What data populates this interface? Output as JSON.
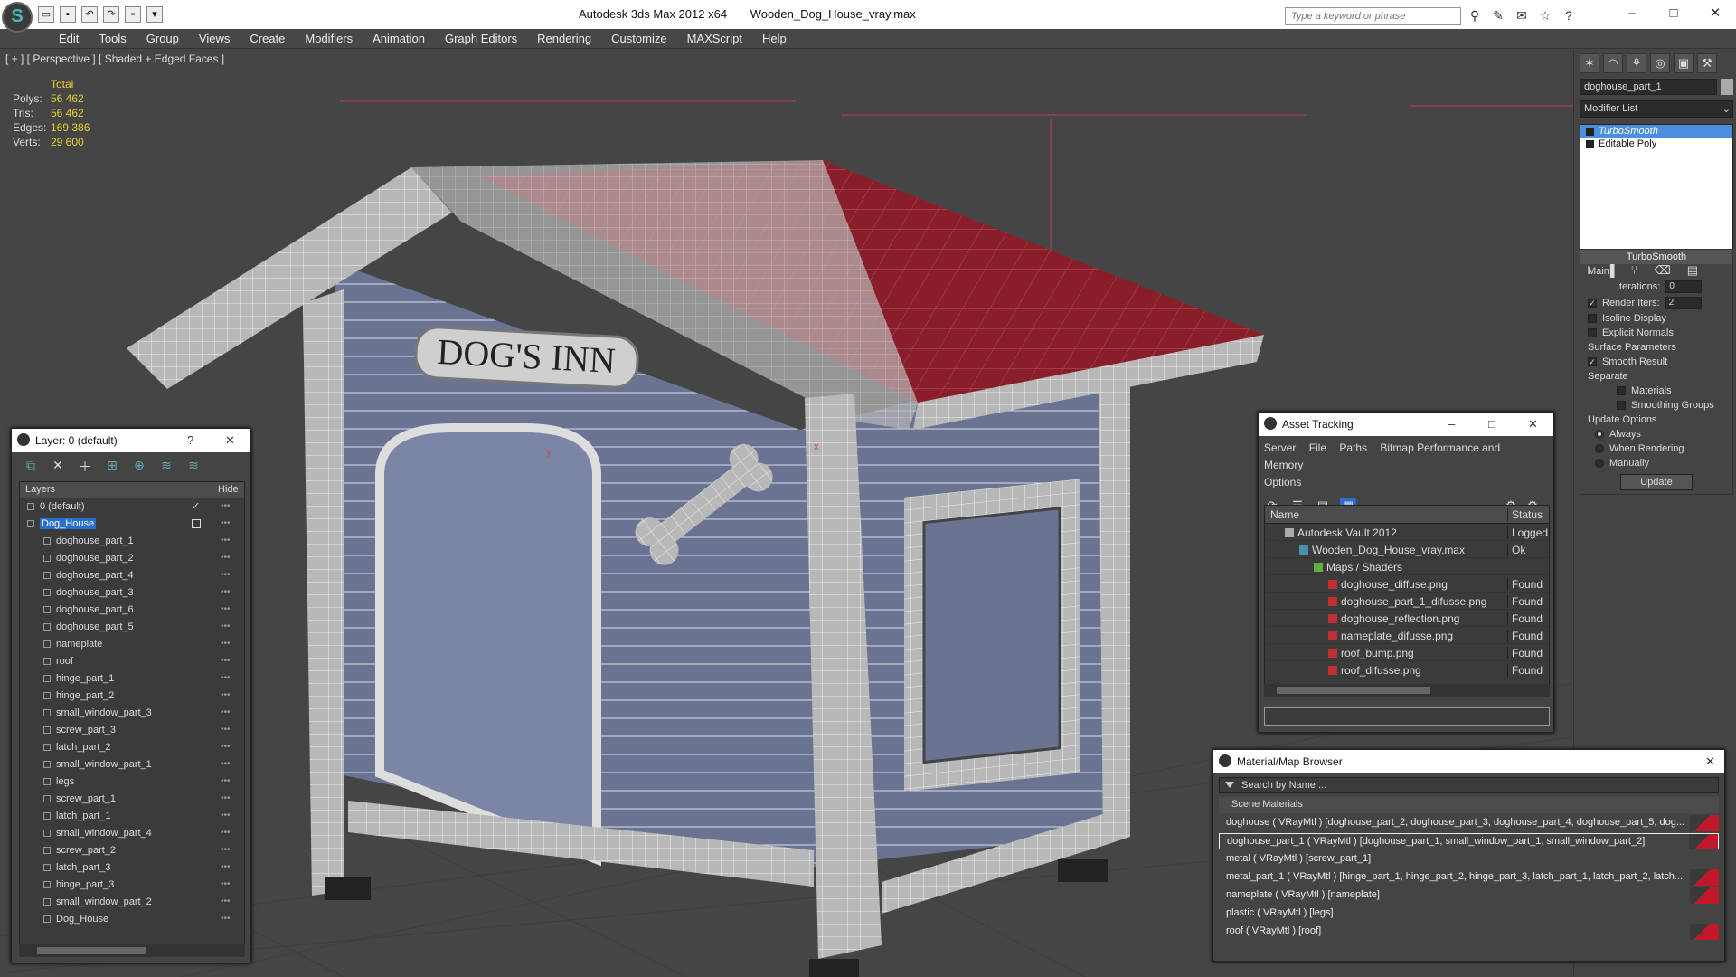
{
  "titlebar": {
    "app": "Autodesk 3ds Max  2012 x64",
    "file": "Wooden_Dog_House_vray.max",
    "search_placeholder": "Type a keyword or phrase",
    "logo_glyph": "S"
  },
  "menu": [
    "Edit",
    "Tools",
    "Group",
    "Views",
    "Create",
    "Modifiers",
    "Animation",
    "Graph Editors",
    "Rendering",
    "Customize",
    "MAXScript",
    "Help"
  ],
  "viewport": {
    "label": "[ + ] [ Perspective ] [ Shaded + Edged Faces ]",
    "stats_header": "Total",
    "stats": [
      {
        "label": "Polys:",
        "value": "56 462"
      },
      {
        "label": "Tris:",
        "value": "56 462"
      },
      {
        "label": "Edges:",
        "value": "169 386"
      },
      {
        "label": "Verts:",
        "value": "29 600"
      }
    ],
    "nameplate_text": "DOG'S INN",
    "axis_x": "x",
    "axis_y": "y"
  },
  "command_panel": {
    "object_name": "doghouse_part_1",
    "modifier_list": "Modifier List",
    "stack": [
      "TurboSmooth",
      "Editable Poly"
    ],
    "rollout_title": "TurboSmooth",
    "main_label": "Main",
    "iterations_label": "Iterations:",
    "iterations_value": "0",
    "render_iters_label": "Render Iters:",
    "render_iters_value": "2",
    "isoline": "Isoline Display",
    "explicit": "Explicit Normals",
    "surface_params": "Surface Parameters",
    "smooth_result": "Smooth Result",
    "separate": "Separate",
    "materials": "Materials",
    "smoothing_groups": "Smoothing Groups",
    "update_options": "Update Options",
    "always": "Always",
    "when_rendering": "When Rendering",
    "manually": "Manually",
    "update_btn": "Update"
  },
  "layer_dialog": {
    "title": "Layer: 0 (default)",
    "col_layers": "Layers",
    "col_hide": "Hide",
    "rows": [
      {
        "name": "0 (default)",
        "level": 0,
        "checked": true
      },
      {
        "name": "Dog_House",
        "level": 0,
        "selected": true
      },
      {
        "name": "doghouse_part_1",
        "level": 1
      },
      {
        "name": "doghouse_part_2",
        "level": 1
      },
      {
        "name": "doghouse_part_4",
        "level": 1
      },
      {
        "name": "doghouse_part_3",
        "level": 1
      },
      {
        "name": "doghouse_part_6",
        "level": 1
      },
      {
        "name": "doghouse_part_5",
        "level": 1
      },
      {
        "name": "nameplate",
        "level": 1
      },
      {
        "name": "roof",
        "level": 1
      },
      {
        "name": "hinge_part_1",
        "level": 1
      },
      {
        "name": "hinge_part_2",
        "level": 1
      },
      {
        "name": "small_window_part_3",
        "level": 1
      },
      {
        "name": "screw_part_3",
        "level": 1
      },
      {
        "name": "latch_part_2",
        "level": 1
      },
      {
        "name": "small_window_part_1",
        "level": 1
      },
      {
        "name": "legs",
        "level": 1
      },
      {
        "name": "screw_part_1",
        "level": 1
      },
      {
        "name": "latch_part_1",
        "level": 1
      },
      {
        "name": "small_window_part_4",
        "level": 1
      },
      {
        "name": "screw_part_2",
        "level": 1
      },
      {
        "name": "latch_part_3",
        "level": 1
      },
      {
        "name": "hinge_part_3",
        "level": 1
      },
      {
        "name": "small_window_part_2",
        "level": 1
      },
      {
        "name": "Dog_House",
        "level": 1
      }
    ]
  },
  "asset_dialog": {
    "title": "Asset Tracking",
    "menu": [
      "Server",
      "File",
      "Paths",
      "Bitmap Performance and Memory",
      "Options"
    ],
    "col_name": "Name",
    "col_status": "Status",
    "rows": [
      {
        "name": "Autodesk Vault 2012",
        "status": "Logged O",
        "indent": 1
      },
      {
        "name": "Wooden_Dog_House_vray.max",
        "status": "Ok",
        "indent": 2
      },
      {
        "name": "Maps / Shaders",
        "status": "",
        "indent": 3
      },
      {
        "name": "doghouse_diffuse.png",
        "status": "Found",
        "indent": 4
      },
      {
        "name": "doghouse_part_1_difusse.png",
        "status": "Found",
        "indent": 4
      },
      {
        "name": "doghouse_reflection.png",
        "status": "Found",
        "indent": 4
      },
      {
        "name": "nameplate_difusse.png",
        "status": "Found",
        "indent": 4
      },
      {
        "name": "roof_bump.png",
        "status": "Found",
        "indent": 4
      },
      {
        "name": "roof_difusse.png",
        "status": "Found",
        "indent": 4
      }
    ]
  },
  "material_dialog": {
    "title": "Material/Map Browser",
    "search_placeholder": "Search by Name ...",
    "category": "Scene Materials",
    "rows": [
      {
        "text": "doghouse ( VRayMtl ) [doghouse_part_2, doghouse_part_3, doghouse_part_4, doghouse_part_5, dog...",
        "swatch": true
      },
      {
        "text": "doghouse_part_1 ( VRayMtl ) [doghouse_part_1, small_window_part_1, small_window_part_2]",
        "swatch": true,
        "selected": true
      },
      {
        "text": "metal ( VRayMtl ) [screw_part_1]",
        "swatch": false
      },
      {
        "text": "metal_part_1 ( VRayMtl ) [hinge_part_1, hinge_part_2, hinge_part_3, latch_part_1, latch_part_2, latch...",
        "swatch": true
      },
      {
        "text": "nameplate ( VRayMtl ) [nameplate]",
        "swatch": true
      },
      {
        "text": "plastic ( VRayMtl ) [legs]",
        "swatch": false
      },
      {
        "text": "roof ( VRayMtl ) [roof]",
        "swatch": true
      }
    ]
  },
  "colors": {
    "accent": "#2a6fd0",
    "stat_value": "#e8d030",
    "roof": "#8a1e28",
    "wall": "#6a7391"
  }
}
